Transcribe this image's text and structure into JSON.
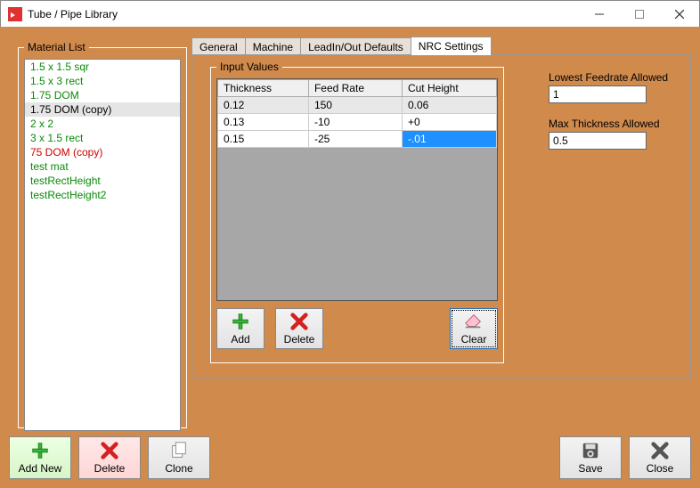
{
  "window": {
    "title": "Tube / Pipe Library"
  },
  "materialList": {
    "legend": "Material List",
    "items": [
      {
        "label": "1.5 x 1.5 sqr",
        "err": false,
        "sel": false
      },
      {
        "label": "1.5 x 3 rect",
        "err": false,
        "sel": false
      },
      {
        "label": "1.75 DOM",
        "err": false,
        "sel": false
      },
      {
        "label": "1.75 DOM (copy)",
        "err": false,
        "sel": true
      },
      {
        "label": "2 x 2",
        "err": false,
        "sel": false
      },
      {
        "label": "3 x 1.5 rect",
        "err": false,
        "sel": false
      },
      {
        "label": "75 DOM (copy)",
        "err": true,
        "sel": false
      },
      {
        "label": "test mat",
        "err": false,
        "sel": false
      },
      {
        "label": "testRectHeight",
        "err": false,
        "sel": false
      },
      {
        "label": "testRectHeight2",
        "err": false,
        "sel": false
      }
    ]
  },
  "tabs": {
    "items": [
      {
        "label": "General",
        "active": false
      },
      {
        "label": "Machine",
        "active": false
      },
      {
        "label": "LeadIn/Out Defaults",
        "active": false
      },
      {
        "label": "NRC Settings",
        "active": true
      }
    ]
  },
  "inputValues": {
    "legend": "Input Values",
    "headers": [
      "Thickness",
      "Feed Rate",
      "Cut Height"
    ],
    "rows": [
      {
        "c": [
          "0.12",
          "150",
          "0.06"
        ],
        "rowSelected": true,
        "selCell": -1
      },
      {
        "c": [
          "0.13",
          "-10",
          "+0"
        ],
        "rowSelected": false,
        "selCell": -1
      },
      {
        "c": [
          "0.15",
          "-25",
          "-.01"
        ],
        "rowSelected": false,
        "selCell": 2
      }
    ],
    "buttons": {
      "add": "Add",
      "delete": "Delete",
      "clear": "Clear"
    }
  },
  "fields": {
    "lowestFeedrate": {
      "label": "Lowest Feedrate Allowed",
      "value": "1"
    },
    "maxThickness": {
      "label": "Max Thickness Allowed",
      "value": "0.5"
    }
  },
  "footer": {
    "addNew": "Add New",
    "delete": "Delete",
    "clone": "Clone",
    "save": "Save",
    "close": "Close"
  }
}
